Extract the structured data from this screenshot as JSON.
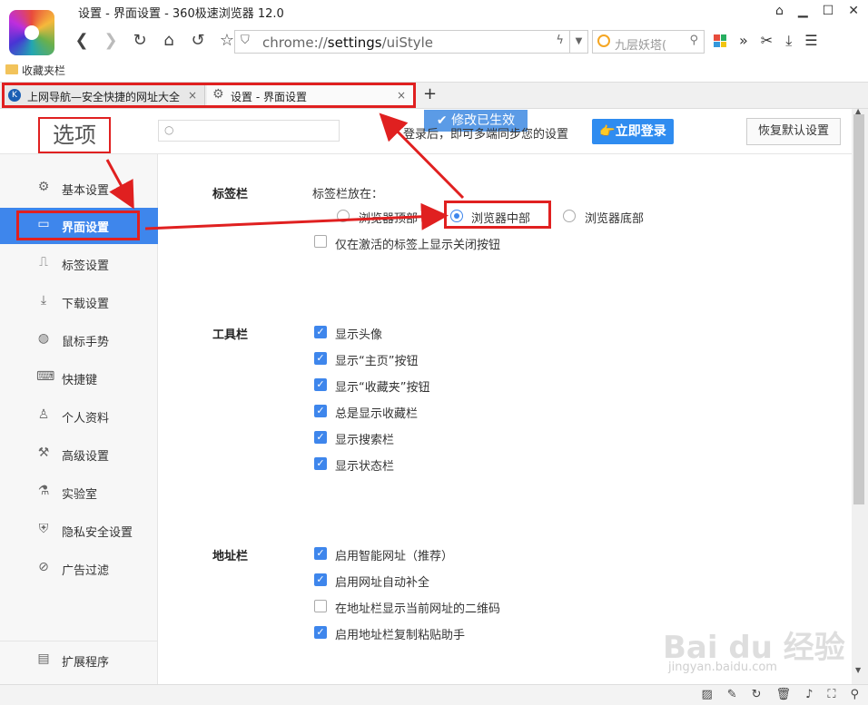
{
  "window": {
    "title": "设置 - 界面设置 - 360极速浏览器 12.0",
    "controls": [
      "⌂",
      "▭",
      "☐",
      "✕"
    ]
  },
  "toolbar": {
    "url_scheme": "chrome://",
    "url_path": "settings",
    "url_rest": "/uiStyle",
    "search_placeholder": "九层妖塔(",
    "overflow": "»"
  },
  "bookmarks": {
    "label": "收藏夹栏"
  },
  "tabs": [
    {
      "label": "上网导航—安全快捷的网址大全",
      "close": "×"
    },
    {
      "label": "设置 - 界面设置",
      "close": "×"
    }
  ],
  "header": {
    "title": "选项",
    "search_placeholder": "○",
    "toast": "修改已生效",
    "login_tip": "登录后，即可多端同步您的设置",
    "login_button": "👉立即登录",
    "reset_button": "恢复默认设置"
  },
  "sidebar": {
    "items": [
      {
        "label": "基本设置"
      },
      {
        "label": "界面设置"
      },
      {
        "label": "标签设置"
      },
      {
        "label": "下载设置"
      },
      {
        "label": "鼠标手势"
      },
      {
        "label": "快捷键"
      },
      {
        "label": "个人资料"
      },
      {
        "label": "高级设置"
      },
      {
        "label": "实验室"
      },
      {
        "label": "隐私安全设置"
      },
      {
        "label": "广告过滤"
      }
    ],
    "extensions": "扩展程序"
  },
  "tabbar_section": {
    "title": "标签栏",
    "position_label": "标签栏放在：",
    "options": [
      "浏览器顶部",
      "浏览器中部",
      "浏览器底部"
    ],
    "selected": "浏览器中部",
    "close_only_active": "仅在激活的标签上显示关闭按钮"
  },
  "toolbar_section": {
    "title": "工具栏",
    "items": [
      "显示头像",
      "显示“主页”按钮",
      "显示“收藏夹”按钮",
      "总是显示收藏栏",
      "显示搜索栏",
      "显示状态栏"
    ]
  },
  "address_section": {
    "title": "地址栏",
    "items": [
      "启用智能网址（推荐）",
      "启用网址自动补全",
      "在地址栏显示当前网址的二维码",
      "启用地址栏复制粘贴助手"
    ]
  },
  "watermark": {
    "main": "Bai du 经验",
    "sub": "jingyan.baidu.com"
  }
}
